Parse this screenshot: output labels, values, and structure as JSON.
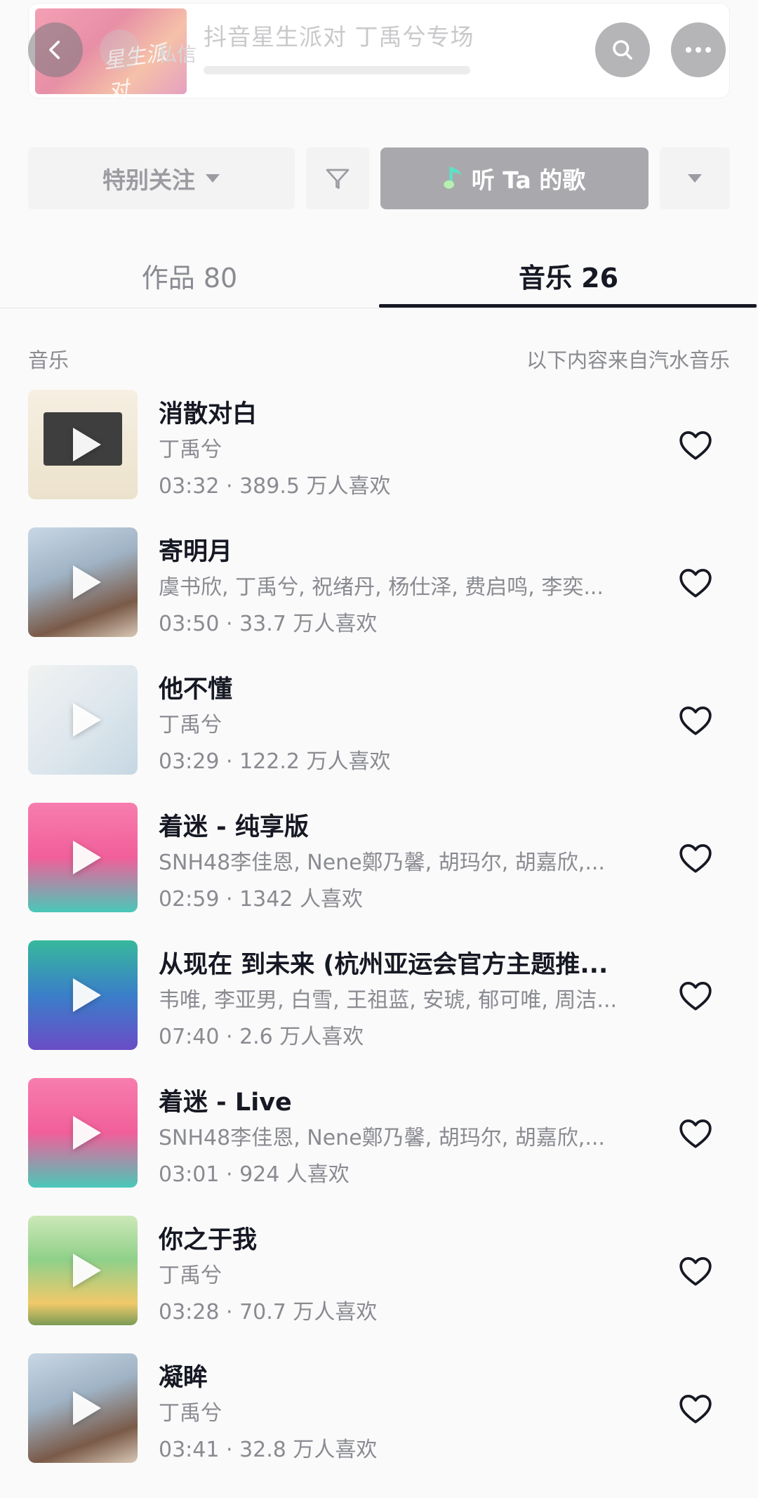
{
  "header": {
    "banner_title": "抖音星生派对 丁禹兮专场",
    "banner_thumb_text": "星生派对",
    "dm_label": "私信",
    "back_icon": "back-arrow-icon",
    "search_icon": "search-icon",
    "more_icon": "more-dots-icon"
  },
  "actions": {
    "follow_label": "特别关注",
    "listen_label": "听 Ta 的歌",
    "listen_icon": "music-note-icon",
    "filter_icon": "filter-icon",
    "dropdown_icon": "chevron-down-icon"
  },
  "tabs": [
    {
      "label": "作品 80",
      "active": false
    },
    {
      "label": "音乐 26",
      "active": true
    }
  ],
  "section": {
    "label": "音乐",
    "source": "以下内容来自汽水音乐"
  },
  "songs": [
    {
      "title": "消散对白",
      "artist": "丁禹兮",
      "meta": "03:32 · 389.5 万人喜欢"
    },
    {
      "title": "寄明月",
      "artist": "虞书欣, 丁禹兮, 祝绪丹, 杨仕泽, 费启鸣, 李奕...",
      "meta": "03:50 · 33.7 万人喜欢"
    },
    {
      "title": "他不懂",
      "artist": "丁禹兮",
      "meta": "03:29 · 122.2 万人喜欢"
    },
    {
      "title": "着迷 - 纯享版",
      "artist": "SNH48李佳恩, Nene鄭乃馨, 胡玛尔, 胡嘉欣,...",
      "meta": "02:59 · 1342 人喜欢"
    },
    {
      "title": "从现在 到未来 (杭州亚运会官方主题推...",
      "artist": "韦唯, 李亚男, 白雪, 王祖蓝, 安琥, 郁可唯, 周洁...",
      "meta": "07:40 · 2.6 万人喜欢"
    },
    {
      "title": "着迷 - Live",
      "artist": "SNH48李佳恩, Nene鄭乃馨, 胡玛尔, 胡嘉欣,...",
      "meta": "03:01 · 924 人喜欢"
    },
    {
      "title": "你之于我",
      "artist": "丁禹兮",
      "meta": "03:28 · 70.7 万人喜欢"
    },
    {
      "title": "凝眸",
      "artist": "丁禹兮",
      "meta": "03:41 · 32.8 万人喜欢"
    }
  ]
}
